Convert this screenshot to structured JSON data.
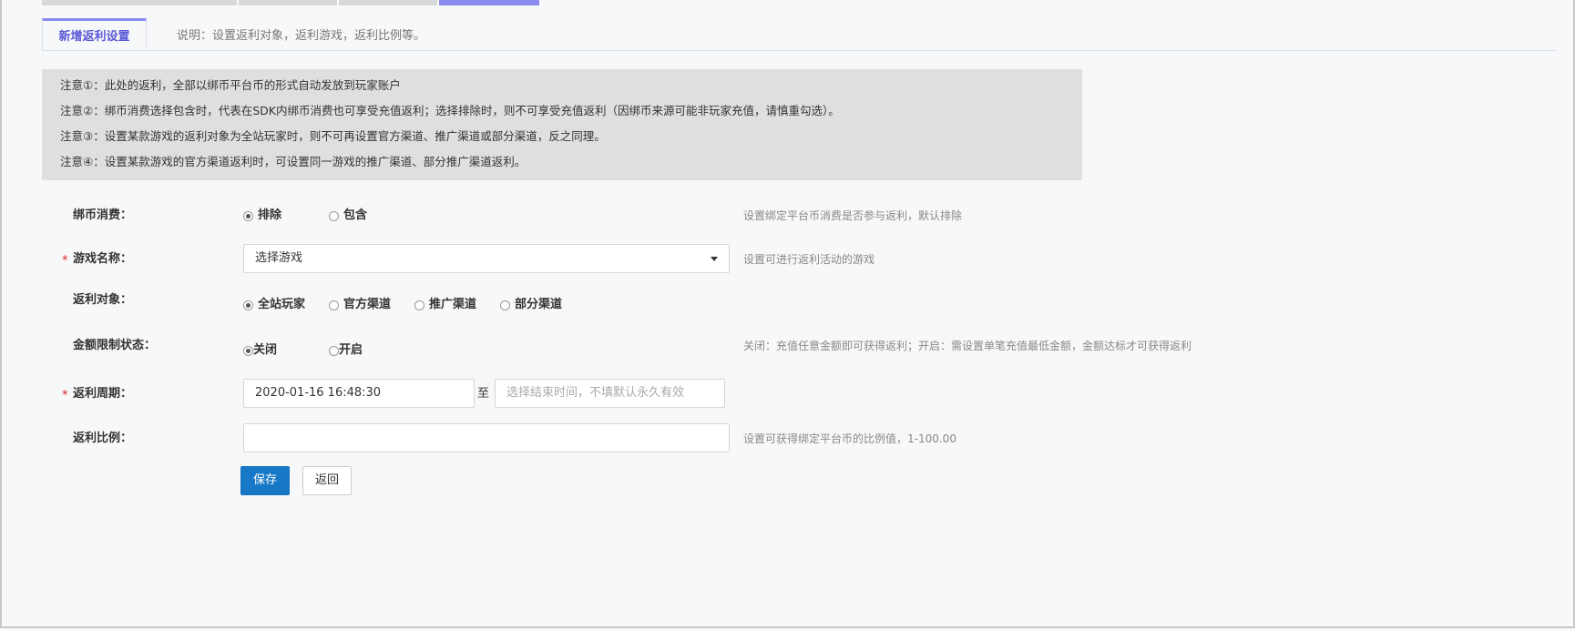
{
  "tabs": {
    "active_label": "新增返利设置",
    "description": "说明：设置返利对象，返利游戏，返利比例等。"
  },
  "notices": [
    "注意①：此处的返利，全部以绑币平台币的形式自动发放到玩家账户",
    "注意②：绑币消费选择包含时，代表在SDK内绑币消费也可享受充值返利；选择排除时，则不可享受充值返利（因绑币来源可能非玩家充值，请慎重勾选）。",
    "注意③：设置某款游戏的返利对象为全站玩家时，则不可再设置官方渠道、推广渠道或部分渠道，反之同理。",
    "注意④：设置某款游戏的官方渠道返利时，可设置同一游戏的推广渠道、部分推广渠道返利。"
  ],
  "form": {
    "bind_coin": {
      "label": "绑币消费：",
      "options": [
        "排除",
        "包含"
      ],
      "selected": "排除",
      "hint": "设置绑定平台币消费是否参与返利，默认排除"
    },
    "game": {
      "required_mark": "*",
      "label": "游戏名称：",
      "value": "选择游戏",
      "hint": "设置可进行返利活动的游戏"
    },
    "target": {
      "label": "返利对象：",
      "options": [
        "全站玩家",
        "官方渠道",
        "推广渠道",
        "部分渠道"
      ],
      "selected": "全站玩家"
    },
    "amount_limit": {
      "label": "金额限制状态：",
      "options": [
        "关闭",
        "开启"
      ],
      "selected": "关闭",
      "hint": "关闭：充值任意金额即可获得返利；开启：需设置单笔充值最低金额，金额达标才可获得返利"
    },
    "period": {
      "required_mark": "*",
      "label": "返利周期：",
      "start_value": "2020-01-16 16:48:30",
      "to_label": "至",
      "end_placeholder": "选择结束时间，不填默认永久有效"
    },
    "ratio": {
      "label": "返利比例：",
      "value": "",
      "hint": "设置可获得绑定平台币的比例值，1-100.00"
    }
  },
  "buttons": {
    "save": "保存",
    "back": "返回"
  },
  "colors": {
    "primary": "#1878c8",
    "tab_accent": "#8c8cf0",
    "required": "#e02020",
    "notice_bg": "#dfdfdf"
  }
}
